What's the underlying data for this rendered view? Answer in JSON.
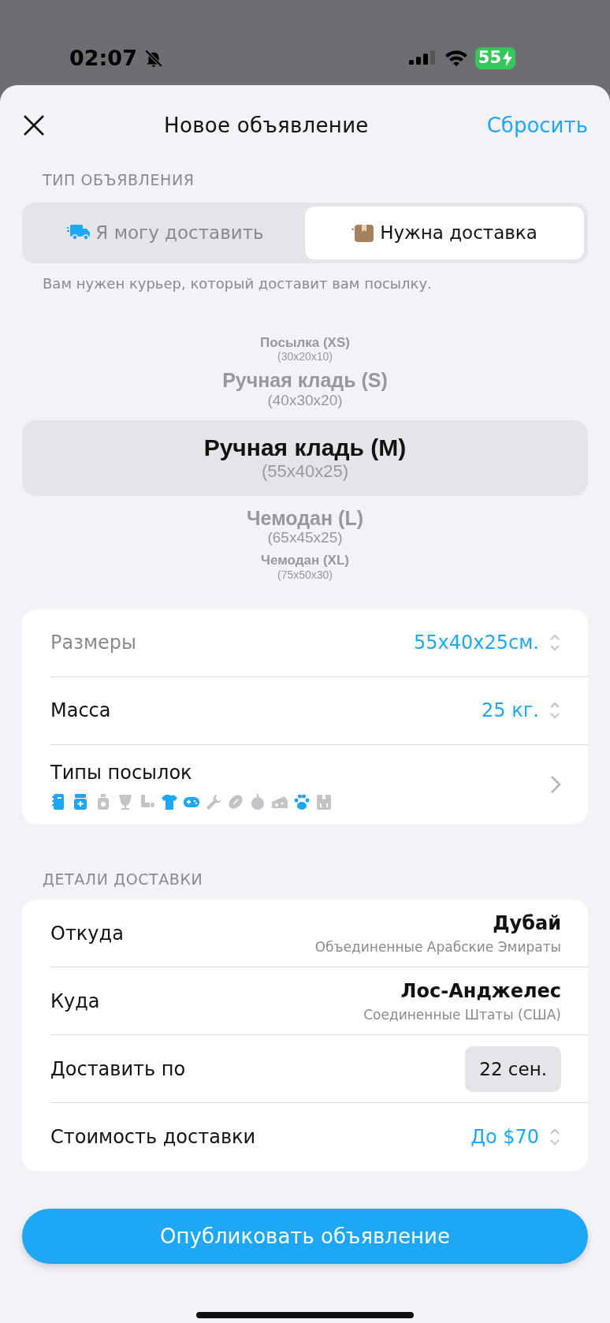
{
  "status_bar": {
    "time": "02:07",
    "battery": "55"
  },
  "header": {
    "title": "Новое объявление",
    "reset": "Сбросить"
  },
  "type_section": {
    "label": "ТИП ОБЪЯВЛЕНИЯ",
    "tabs": [
      {
        "label": "Я могу доставить",
        "selected": false
      },
      {
        "label": "Нужна доставка",
        "selected": true
      }
    ],
    "hint": "Вам нужен курьер, который доставит вам посылку."
  },
  "size_picker": [
    {
      "name": "Посылка (XS)",
      "dims": "(30x20x10)",
      "selected": false
    },
    {
      "name": "Ручная кладь (S)",
      "dims": "(40x30x20)",
      "selected": false
    },
    {
      "name": "Ручная кладь (M)",
      "dims": "(55x40x25)",
      "selected": true
    },
    {
      "name": "Чемодан (L)",
      "dims": "(65x45x25)",
      "selected": false
    },
    {
      "name": "Чемодан (XL)",
      "dims": "(75x50x30)",
      "selected": false
    }
  ],
  "parcel_card": [
    {
      "kind": "stepper",
      "label": "Размеры",
      "value": "55x40x25см.",
      "disabled": true
    },
    {
      "kind": "stepper",
      "label": "Масса",
      "value": "25 кг.",
      "disabled": false
    },
    {
      "kind": "types",
      "label": "Типы посылок",
      "disabled": false,
      "types": [
        {
          "kind": "notebook",
          "on": true
        },
        {
          "kind": "medicine",
          "on": true
        },
        {
          "kind": "bottle",
          "on": false
        },
        {
          "kind": "glass",
          "on": false
        },
        {
          "kind": "pipe",
          "on": false
        },
        {
          "kind": "shirt",
          "on": true
        },
        {
          "kind": "gamepad",
          "on": true
        },
        {
          "kind": "wrench",
          "on": false
        },
        {
          "kind": "ball",
          "on": false
        },
        {
          "kind": "apple",
          "on": false
        },
        {
          "kind": "cheese",
          "on": false
        },
        {
          "kind": "paw",
          "on": true
        },
        {
          "kind": "box",
          "on": false
        }
      ]
    }
  ],
  "delivery_section": {
    "label": "ДЕТАЛИ ДОСТАВКИ",
    "rows": [
      {
        "kind": "place",
        "label": "Откуда",
        "value": "Дубай",
        "sub": "Объединенные Арабские Эмираты"
      },
      {
        "kind": "place",
        "label": "Куда",
        "value": "Лос-Анджелес",
        "sub": "Соединенные Штаты (США)"
      },
      {
        "kind": "date",
        "label": "Доставить по",
        "value": "22 сен."
      },
      {
        "kind": "stepper",
        "label": "Стоимость доставки",
        "value": "До $70"
      }
    ]
  },
  "publish_button": "Опубликовать объявление"
}
